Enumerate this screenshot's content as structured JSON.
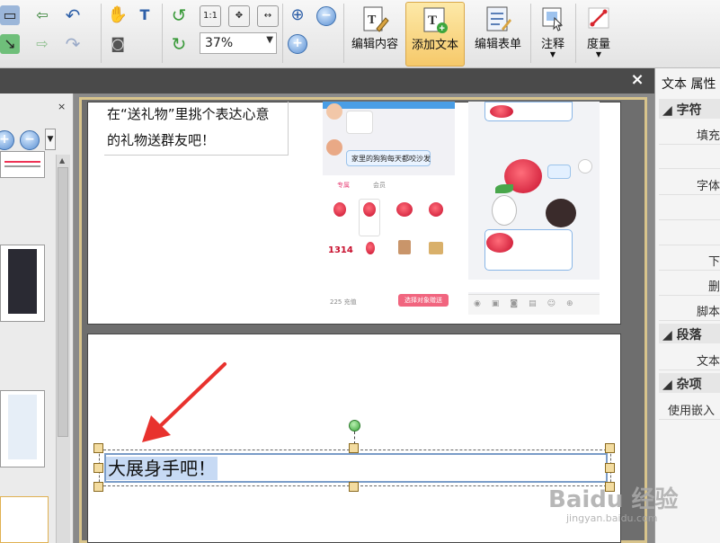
{
  "toolbar": {
    "zoom_value": "37%",
    "buttons": [
      {
        "label": "编辑内容"
      },
      {
        "label": "添加文本"
      },
      {
        "label": "编辑表单"
      },
      {
        "label": "注释"
      },
      {
        "label": "度量"
      }
    ],
    "active_button": "添加文本",
    "accent_color": "#f6c96a"
  },
  "document": {
    "page1_note_lines": [
      "在“送礼物”里挑个表达心意",
      "的礼物送群友吧！"
    ],
    "page1_chat_bubble": "家里的狗狗每天都咬沙发",
    "page1_tabs": [
      "专属",
      "会员"
    ],
    "page1_gift_numbers": [
      "1314"
    ],
    "page1_button": "选择对象赠送",
    "page1_balance": "225 充值",
    "page2_textbox_text": "大展身手吧！"
  },
  "right_panel": {
    "title": "文本 属性",
    "sections": [
      {
        "name": "字符",
        "rows": [
          "填充",
          "字体",
          "下",
          "删",
          "脚本"
        ]
      },
      {
        "name": "段落",
        "rows": [
          "文本"
        ]
      },
      {
        "name": "杂项",
        "rows": [
          "使用嵌入"
        ]
      }
    ]
  },
  "watermark": {
    "text": "Baidu 经验",
    "url": "jingyan.baidu.com"
  }
}
